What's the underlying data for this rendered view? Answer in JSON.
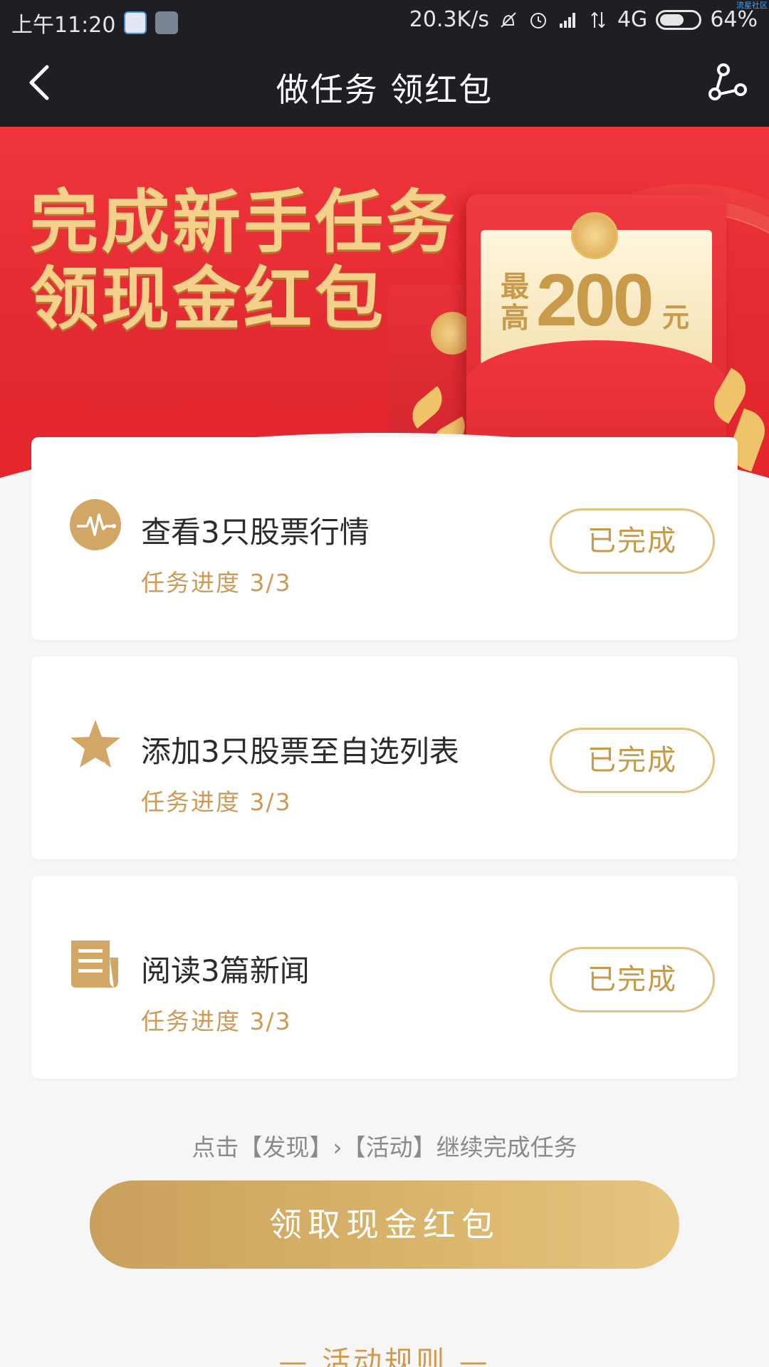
{
  "status_bar": {
    "time": "上午11:20",
    "net_speed": "20.3K/s",
    "network": "4G",
    "battery": "64%",
    "battery_level": 0.64,
    "corner_tag": "流星社区"
  },
  "header": {
    "title": "做任务 领红包"
  },
  "banner": {
    "line1": "完成新手任务",
    "line2": "领现金红包",
    "max_label": "最高",
    "amount": "200",
    "unit": "元"
  },
  "tasks": [
    {
      "title": "查看3只股票行情",
      "progress": "任务进度 3/3",
      "status": "已完成",
      "icon": "pulse-icon"
    },
    {
      "title": "添加3只股票至自选列表",
      "progress": "任务进度 3/3",
      "status": "已完成",
      "icon": "star-icon"
    },
    {
      "title": "阅读3篇新闻",
      "progress": "任务进度 3/3",
      "status": "已完成",
      "icon": "news-icon"
    }
  ],
  "hint": "点击【发现】›【活动】继续完成任务",
  "claim_button": "领取现金红包",
  "rules_link": "— 活动规则 —",
  "colors": {
    "header_bg": "#1d1f24",
    "banner_red": "#e8313a",
    "gold": "#cd9a56"
  }
}
